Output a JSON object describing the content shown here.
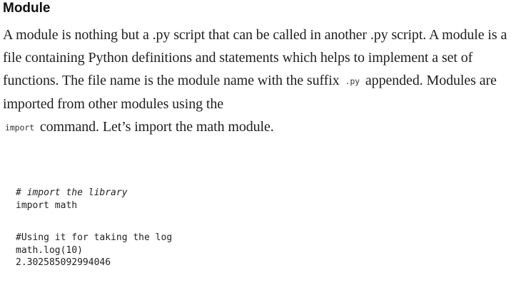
{
  "heading": "Module",
  "paragraph": {
    "part1": "A module is nothing but a .py script that can be called in another .py script. A module is a file containing Python definitions and statements which helps to implement a set of functions. The file name is the module name with the suffix",
    "code1": ".py",
    "part2": "appended. Modules are imported from other modules using the",
    "code2": "import",
    "part3": "command. Let’s import the math module."
  },
  "code": {
    "line1": "# import the library",
    "line2": "import math",
    "line3": "#Using it for taking the log",
    "line4": "math.log(10)",
    "line5": "2.302585092994046"
  }
}
